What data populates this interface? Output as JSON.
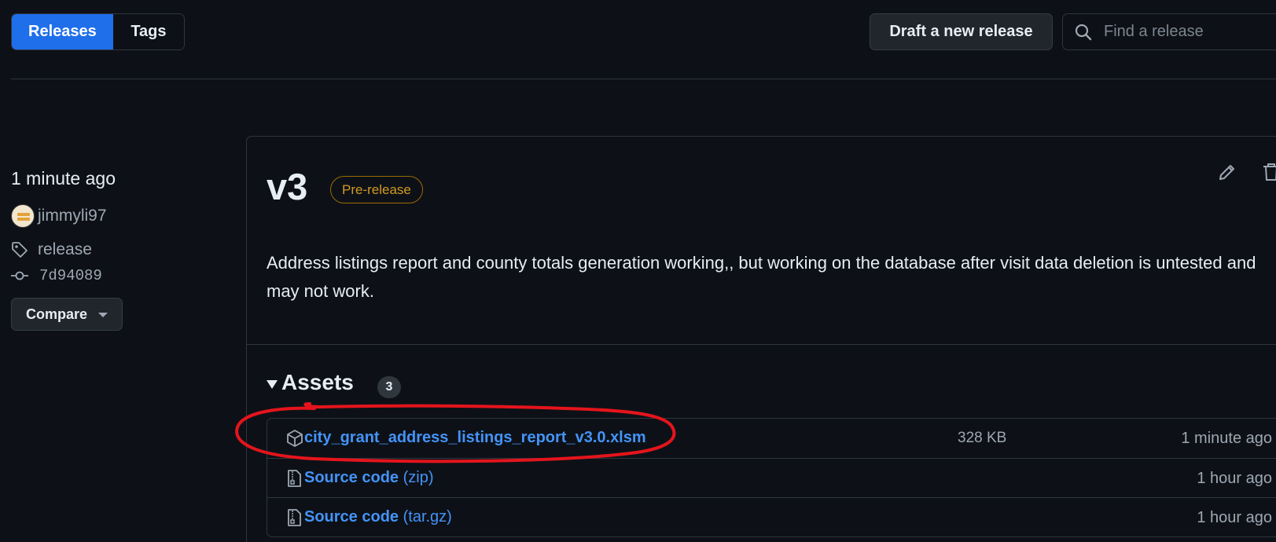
{
  "nav": {
    "releases_tab": "Releases",
    "tags_tab": "Tags",
    "draft_button": "Draft a new release",
    "search_placeholder": "Find a release"
  },
  "meta": {
    "time": "1 minute ago",
    "author": "jimmyli97",
    "tag": "release",
    "commit": "7d94089",
    "compare_button": "Compare"
  },
  "release": {
    "title": "v3",
    "badge": "Pre-release",
    "body": "Address listings report and county totals generation working,, but working on the database after visit data deletion is untested and may not work."
  },
  "assets": {
    "heading": "Assets",
    "count": "3",
    "items": [
      {
        "name": "city_grant_address_listings_report_v3.0.xlsm",
        "suffix": "",
        "size": "328 KB",
        "time": "1 minute ago",
        "icon": "package-icon"
      },
      {
        "name": "Source code",
        "suffix": " (zip)",
        "size": "",
        "time": "1 hour ago",
        "icon": "file-zip-icon"
      },
      {
        "name": "Source code",
        "suffix": " (tar.gz)",
        "size": "",
        "time": "1 hour ago",
        "icon": "file-zip-icon"
      }
    ]
  },
  "colors": {
    "background": "#0d1117",
    "accent": "#1f6feb",
    "link": "#4493f8",
    "prerelease": "#d29922",
    "annotation": "#e5141c"
  }
}
